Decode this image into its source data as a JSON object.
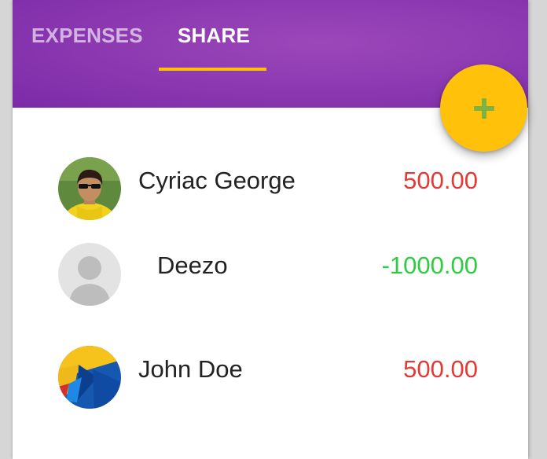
{
  "tabs": [
    {
      "label": "EXPENSES",
      "selected": false
    },
    {
      "label": "SHARE",
      "selected": true
    }
  ],
  "fab": {
    "icon": "plus-icon"
  },
  "colors": {
    "appbar": "#8e3bb2",
    "indicator": "#ffc107",
    "fab": "#ffc10a",
    "owed": "#e53935",
    "owing": "#2ecc40"
  },
  "shares": [
    {
      "name": "Cyriac George",
      "amount": "500.00",
      "avatar": "person-photo-avatar"
    },
    {
      "name": "Deezo",
      "amount": "-1000.00",
      "avatar": "default-person-avatar"
    },
    {
      "name": "John Doe",
      "amount": "500.00",
      "avatar": "blue-yellow-abstract-avatar"
    }
  ]
}
